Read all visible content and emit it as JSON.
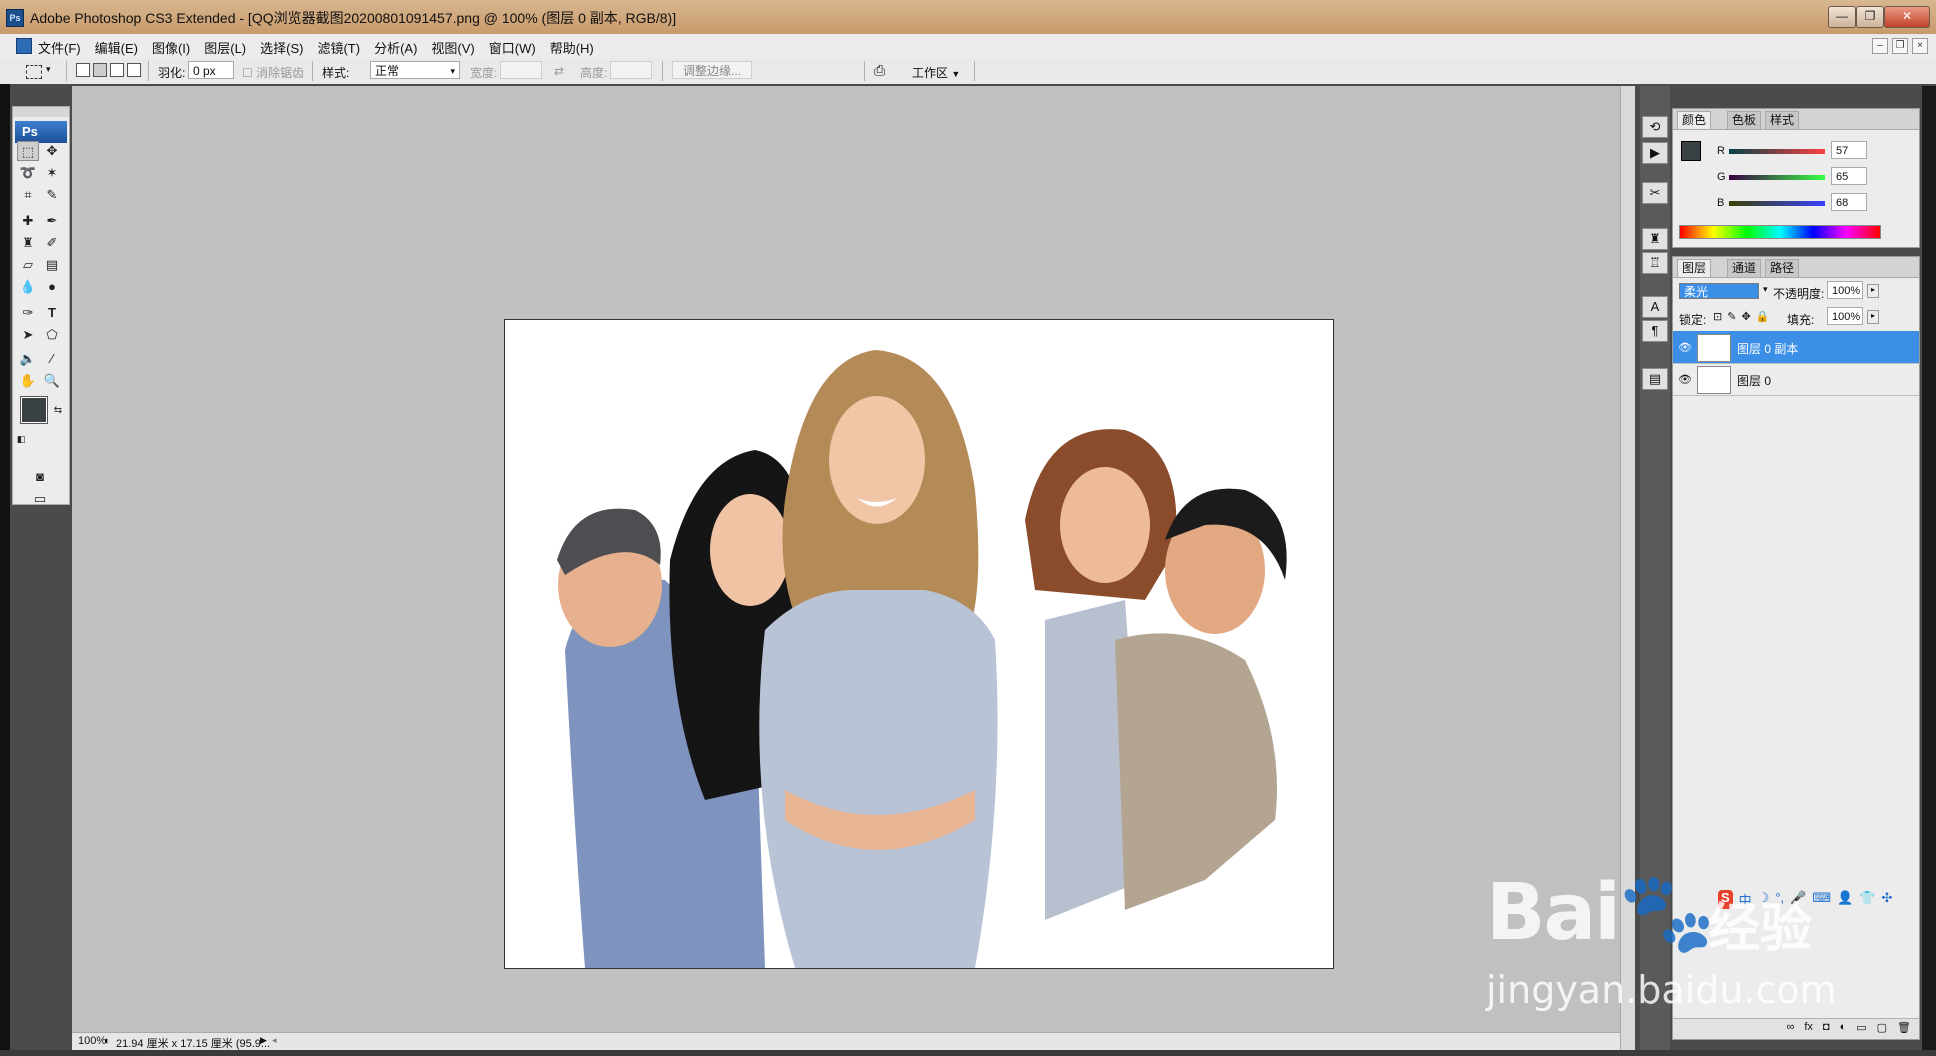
{
  "window": {
    "title": "Adobe Photoshop CS3 Extended - [QQ浏览器截图20200801091457.png @ 100% (图层 0 副本, RGB/8)]",
    "controls": [
      "—",
      "❐",
      "✕"
    ]
  },
  "menubar": {
    "items": [
      "文件(F)",
      "编辑(E)",
      "图像(I)",
      "图层(L)",
      "选择(S)",
      "滤镜(T)",
      "分析(A)",
      "视图(V)",
      "窗口(W)",
      "帮助(H)"
    ]
  },
  "options": {
    "feather_label": "羽化:",
    "feather_value": "0 px",
    "antialias_label": "消除锯齿",
    "style_label": "样式:",
    "style_value": "正常",
    "width_label": "宽度:",
    "height_label": "高度:",
    "refine_edge": "调整边缘...",
    "workspace_label": "工作区"
  },
  "toolbox": {
    "logo": "Ps"
  },
  "status": {
    "zoom": "100%",
    "doc_info": "21.94 厘米 x 17.15 厘米 (95.9..."
  },
  "color_panel": {
    "tabs": [
      "颜色",
      "色板",
      "样式"
    ],
    "r_label": "R",
    "r_value": "57",
    "g_label": "G",
    "g_value": "65",
    "b_label": "B",
    "b_value": "68",
    "fg_color": "#394144"
  },
  "layers_panel": {
    "tabs": [
      "图层",
      "通道",
      "路径"
    ],
    "blend_mode": "柔光",
    "opacity_label": "不透明度:",
    "opacity_value": "100%",
    "lock_label": "锁定:",
    "fill_label": "填充:",
    "fill_value": "100%",
    "layers": [
      {
        "name": "图层 0 副本",
        "selected": true
      },
      {
        "name": "图层 0",
        "selected": false
      }
    ]
  },
  "watermark": {
    "brand": "Bai",
    "brand_cn": "经验",
    "url": "jingyan.baidu.com"
  },
  "ime": {
    "logo": "S",
    "lang": "中"
  },
  "colors": {
    "selection": "#3c8fe6",
    "workspace_bg": "#c0c0c0",
    "title_bar": "#c89a6a"
  }
}
